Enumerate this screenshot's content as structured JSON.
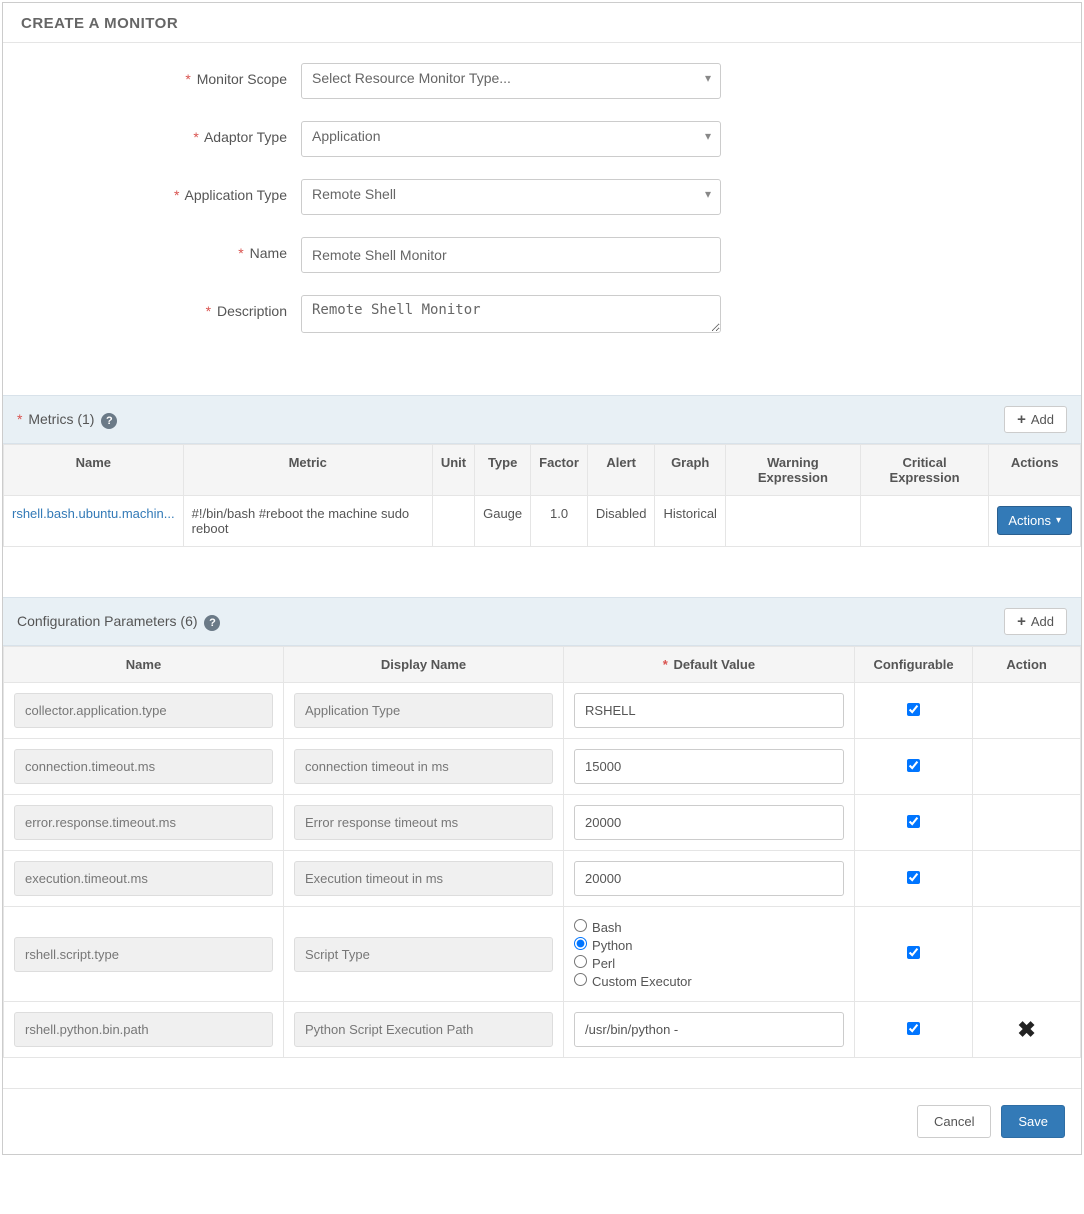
{
  "header": {
    "title": "CREATE A MONITOR"
  },
  "form": {
    "monitor_scope_label": "Monitor Scope",
    "monitor_scope_value": "Select Resource Monitor Type...",
    "adaptor_type_label": "Adaptor Type",
    "adaptor_type_value": "Application",
    "application_type_label": "Application Type",
    "application_type_value": "Remote Shell",
    "name_label": "Name",
    "name_value": "Remote Shell Monitor",
    "description_label": "Description",
    "description_value": "Remote Shell Monitor"
  },
  "metrics_panel": {
    "title_prefix": "Metrics",
    "count": "(1)",
    "add_label": "Add",
    "columns": [
      "Name",
      "Metric",
      "Unit",
      "Type",
      "Factor",
      "Alert",
      "Graph",
      "Warning Expression",
      "Critical Expression",
      "Actions"
    ],
    "rows": [
      {
        "name": "rshell.bash.ubuntu.machin...",
        "metric": "#!/bin/bash #reboot the machine sudo reboot",
        "unit": "",
        "type": "Gauge",
        "factor": "1.0",
        "alert": "Disabled",
        "graph": "Historical",
        "warning": "",
        "critical": "",
        "actions_label": "Actions"
      }
    ]
  },
  "config_panel": {
    "title_prefix": "Configuration Parameters",
    "count": "(6)",
    "add_label": "Add",
    "columns": [
      "Name",
      "Display Name",
      "Default Value",
      "Configurable",
      "Action"
    ],
    "default_value_required": true,
    "rows": [
      {
        "name": "collector.application.type",
        "display": "Application Type",
        "value": "RSHELL",
        "value_type": "text",
        "configurable": true,
        "deletable": false
      },
      {
        "name": "connection.timeout.ms",
        "display": "connection timeout in ms",
        "value": "15000",
        "value_type": "text",
        "configurable": true,
        "deletable": false
      },
      {
        "name": "error.response.timeout.ms",
        "display": "Error response timeout ms",
        "value": "20000",
        "value_type": "text",
        "configurable": true,
        "deletable": false
      },
      {
        "name": "execution.timeout.ms",
        "display": "Execution timeout in ms",
        "value": "20000",
        "value_type": "text",
        "configurable": true,
        "deletable": false
      },
      {
        "name": "rshell.script.type",
        "display": "Script Type",
        "value_type": "radio",
        "options": [
          "Bash",
          "Python",
          "Perl",
          "Custom Executor"
        ],
        "selected": "Python",
        "configurable": true,
        "deletable": false
      },
      {
        "name": "rshell.python.bin.path",
        "display": "Python Script Execution Path",
        "value": "/usr/bin/python -",
        "value_type": "text",
        "configurable": true,
        "deletable": true
      }
    ]
  },
  "footer": {
    "cancel": "Cancel",
    "save": "Save"
  }
}
